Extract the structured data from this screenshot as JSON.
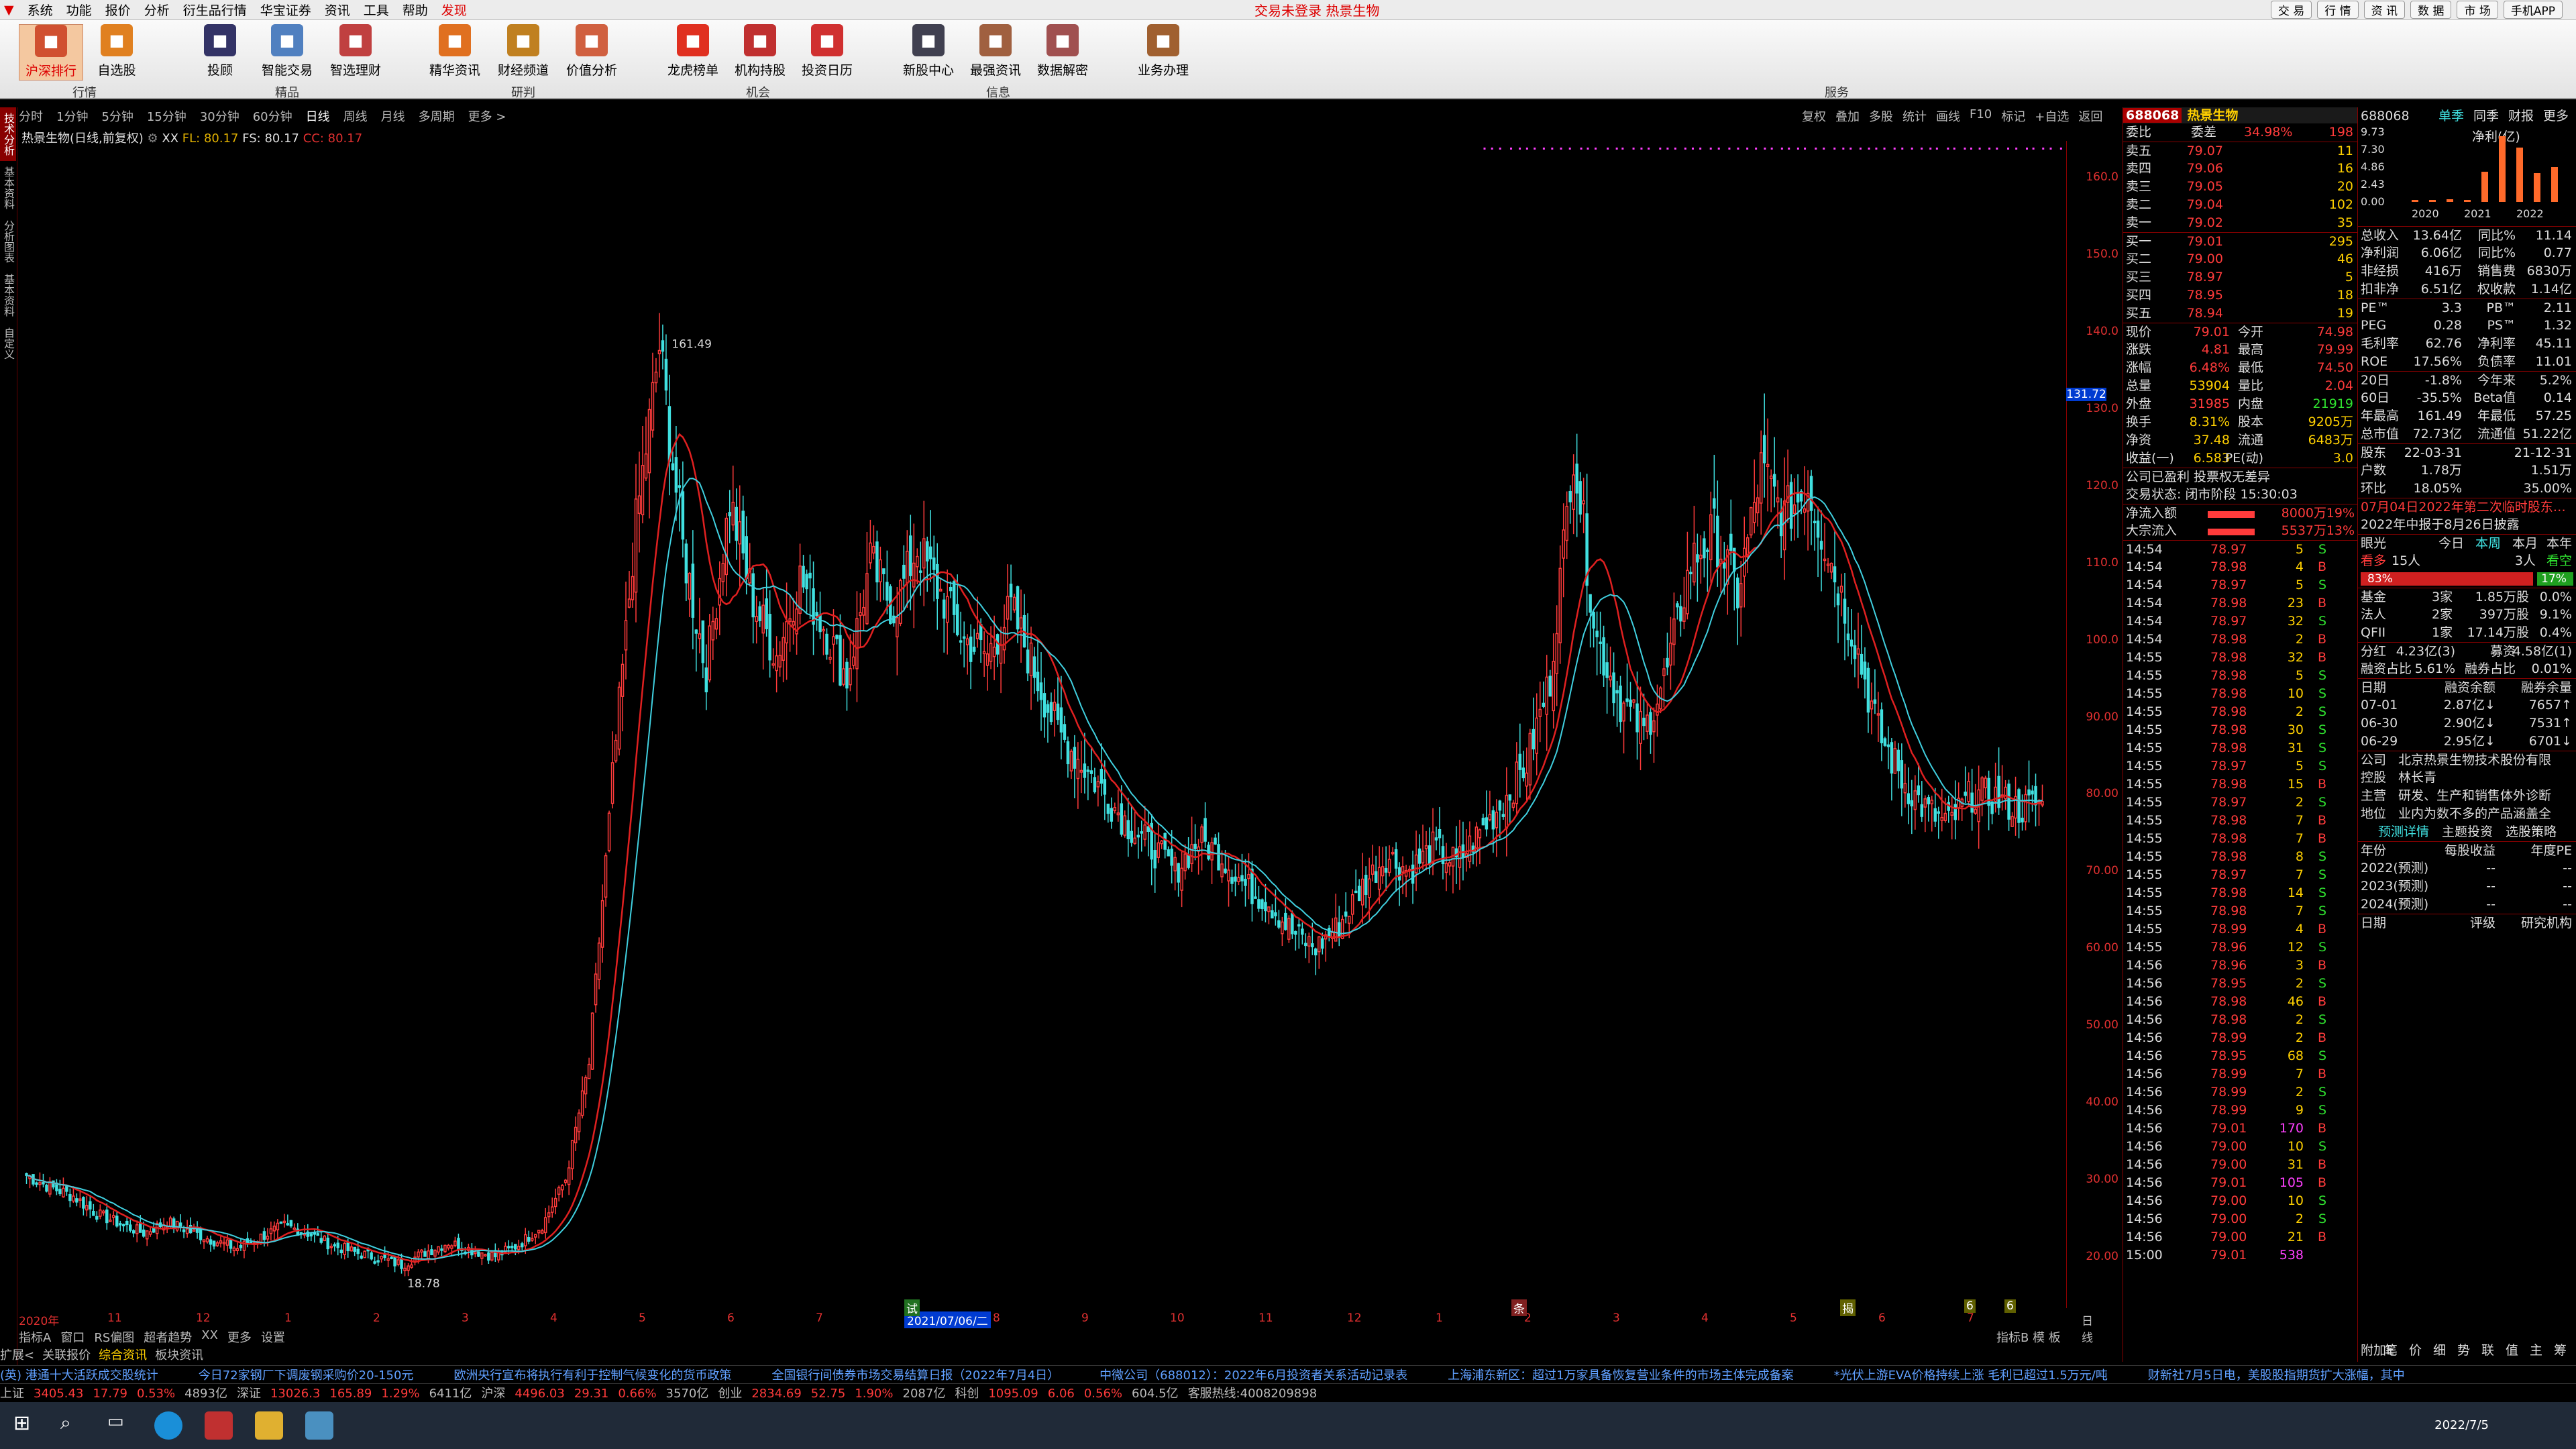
{
  "menu": {
    "items": [
      "系统",
      "功能",
      "报价",
      "分析",
      "衍生品行情",
      "华宝证券",
      "资讯",
      "工具",
      "帮助",
      "发现"
    ],
    "title": "交易未登录  热景生物",
    "right": [
      "交 易",
      "行 情",
      "资 讯",
      "数 据",
      "市 场",
      "手机APP"
    ]
  },
  "toolbar": {
    "items": [
      {
        "label": "沪深排行",
        "icon": "ranking-icon",
        "color": "#d05030"
      },
      {
        "label": "自选股",
        "icon": "star-icon",
        "color": "#e08020"
      },
      {
        "label": "投顾",
        "icon": "advisor-icon",
        "color": "#333366"
      },
      {
        "label": "智能交易",
        "icon": "smart-trade-icon",
        "color": "#5080c0"
      },
      {
        "label": "智选理财",
        "icon": "finance-icon",
        "color": "#c04040"
      },
      {
        "label": "精华资讯",
        "icon": "news-icon",
        "color": "#e07020"
      },
      {
        "label": "财经频道",
        "icon": "channel-icon",
        "color": "#c08020"
      },
      {
        "label": "价值分析",
        "icon": "value-icon",
        "color": "#d06040"
      },
      {
        "label": "龙虎榜单",
        "icon": "fire-icon",
        "color": "#e03020"
      },
      {
        "label": "机构持股",
        "icon": "institution-icon",
        "color": "#c03030"
      },
      {
        "label": "投资日历",
        "icon": "calendar-icon",
        "color": "#d03030"
      },
      {
        "label": "新股中心",
        "icon": "ipo-icon",
        "color": "#404050"
      },
      {
        "label": "最强资讯",
        "icon": "doc-icon",
        "color": "#a06040"
      },
      {
        "label": "数据解密",
        "icon": "data-icon",
        "color": "#a05050"
      },
      {
        "label": "业务办理",
        "icon": "briefcase-icon",
        "color": "#a06030"
      }
    ],
    "groups": [
      "行情",
      "精品",
      "研判",
      "机会",
      "信息",
      "服务"
    ]
  },
  "periods": [
    "分时",
    "1分钟",
    "5分钟",
    "15分钟",
    "30分钟",
    "60分钟",
    "日线",
    "周线",
    "月线",
    "多周期",
    "更多 >"
  ],
  "chart_tools": [
    "复权",
    "叠加",
    "多股",
    "统计",
    "画线",
    "F10",
    "标记",
    "+自选",
    "返回"
  ],
  "left_tabs": [
    "技术分析",
    "基本资料",
    "分析图表",
    "基本资料",
    "自定义"
  ],
  "chart_title": {
    "name": "热景生物(日线,前复权)",
    "ma1": "XX",
    "ma2": "FL: 80.17",
    "ma3": "FS: 80.17",
    "ma4": "CC: 80.17"
  },
  "y_axis": [
    "160.0",
    "150.0",
    "140.0",
    "130.0",
    "120.0",
    "110.0",
    "100.0",
    "90.00",
    "80.00",
    "70.00",
    "60.00",
    "50.00",
    "40.00",
    "30.00",
    "20.00"
  ],
  "current_price_tag": "131.72",
  "chart_data": {
    "type": "candlestick",
    "x_ticks": [
      "2020年",
      "11",
      "12",
      "1",
      "2",
      "3",
      "4",
      "5",
      "6",
      "7",
      "2021/07/06/二",
      "8",
      "9",
      "10",
      "11",
      "12",
      "1",
      "2",
      "3",
      "4",
      "5",
      "6",
      "7"
    ],
    "markers": [
      {
        "label": "试"
      },
      {
        "label": "条"
      },
      {
        "label": "揭"
      },
      {
        "label": "6"
      },
      {
        "label": "6"
      }
    ],
    "high_label": "161.49",
    "low_label": "18.78",
    "ylim": [
      15,
      163
    ],
    "series": [
      {
        "name": "FL",
        "color": "#e02020"
      },
      {
        "name": "FS",
        "color": "#40d0e0"
      }
    ],
    "closes": [
      30.5,
      29.0,
      27.8,
      25.5,
      24.2,
      23.0,
      24.5,
      23.2,
      22.0,
      21.0,
      22.5,
      24.0,
      23.0,
      21.5,
      20.5,
      19.8,
      18.9,
      20.5,
      21.8,
      20.8,
      20.0,
      21.5,
      24.0,
      30.0,
      45.0,
      82.0,
      115.0,
      138.0,
      112.0,
      96.0,
      118.0,
      105.0,
      98.0,
      108.0,
      102.0,
      95.0,
      110.0,
      104.0,
      112.0,
      106.0,
      100.0,
      98.0,
      104.0,
      96.0,
      88.0,
      84.0,
      80.0,
      76.0,
      73.0,
      70.0,
      74.0,
      72.0,
      68.0,
      66.0,
      62.0,
      60.0,
      63.0,
      68.0,
      72.0,
      70.0,
      73.0,
      71.0,
      75.0,
      79.0,
      84.0,
      95.0,
      125.0,
      100.0,
      92.0,
      88.0,
      96.0,
      110.0,
      114.0,
      106.0,
      122.0,
      116.0,
      120.0,
      110.0,
      100.0,
      88.0,
      82.0,
      78.0,
      76.0,
      80.0,
      79.5,
      78.0,
      79.0
    ]
  },
  "right_axis_tag": "日线",
  "bottom_tabs": [
    "指标A",
    "窗口",
    "RS偏图",
    "超者趋势",
    "XX",
    "更多",
    "设置"
  ],
  "bottom_tabs2": [
    "扩展<",
    "关联报价",
    "综合资讯",
    "板块资讯"
  ],
  "bottom_right_tabs": "指标B 模 板",
  "quote": {
    "code": "688068",
    "name": "热景生物",
    "ratio_label": "委比",
    "ratio": "34.98%",
    "diff_label": "委差",
    "diff": "198",
    "asks": [
      {
        "l": "卖五",
        "p": "79.07",
        "v": "11"
      },
      {
        "l": "卖四",
        "p": "79.06",
        "v": "16"
      },
      {
        "l": "卖三",
        "p": "79.05",
        "v": "20"
      },
      {
        "l": "卖二",
        "p": "79.04",
        "v": "102"
      },
      {
        "l": "卖一",
        "p": "79.02",
        "v": "35"
      }
    ],
    "bids": [
      {
        "l": "买一",
        "p": "79.01",
        "v": "295"
      },
      {
        "l": "买二",
        "p": "79.00",
        "v": "46"
      },
      {
        "l": "买三",
        "p": "78.97",
        "v": "5"
      },
      {
        "l": "买四",
        "p": "78.95",
        "v": "18"
      },
      {
        "l": "买五",
        "p": "78.94",
        "v": "19"
      }
    ],
    "stats": [
      [
        "现价",
        "79.01",
        "今开",
        "74.98"
      ],
      [
        "涨跌",
        "4.81",
        "最高",
        "79.99"
      ],
      [
        "涨幅",
        "6.48%",
        "最低",
        "74.50"
      ],
      [
        "总量",
        "53904",
        "量比",
        "2.04"
      ],
      [
        "外盘",
        "31985",
        "内盘",
        "21919"
      ],
      [
        "换手",
        "8.31%",
        "股本",
        "9205万"
      ],
      [
        "净资",
        "37.48",
        "流通",
        "6483万"
      ],
      [
        "收益(一)",
        "6.583",
        "PE(动)",
        "3.0"
      ]
    ],
    "note1": "公司已盈利 投票权无差异",
    "note2": "交易状态: 闭市阶段 15:30:03",
    "flow": [
      [
        "净流入额",
        "8000万",
        "19%"
      ],
      [
        "大宗流入",
        "5537万",
        "13%"
      ]
    ],
    "ticks": [
      [
        "14:54",
        "78.97",
        "5",
        "S"
      ],
      [
        "14:54",
        "78.98",
        "4",
        "B"
      ],
      [
        "14:54",
        "78.97",
        "5",
        "S"
      ],
      [
        "14:54",
        "78.98",
        "23",
        "B"
      ],
      [
        "14:54",
        "78.97",
        "32",
        "S"
      ],
      [
        "14:54",
        "78.98",
        "2",
        "B"
      ],
      [
        "14:55",
        "78.98",
        "32",
        "B"
      ],
      [
        "14:55",
        "78.98",
        "5",
        "S"
      ],
      [
        "14:55",
        "78.98",
        "10",
        "S"
      ],
      [
        "14:55",
        "78.98",
        "2",
        "S"
      ],
      [
        "14:55",
        "78.98",
        "30",
        "S"
      ],
      [
        "14:55",
        "78.98",
        "31",
        "S"
      ],
      [
        "14:55",
        "78.97",
        "5",
        "S"
      ],
      [
        "14:55",
        "78.98",
        "15",
        "B"
      ],
      [
        "14:55",
        "78.97",
        "2",
        "S"
      ],
      [
        "14:55",
        "78.98",
        "7",
        "B"
      ],
      [
        "14:55",
        "78.98",
        "7",
        "B"
      ],
      [
        "14:55",
        "78.98",
        "8",
        "S"
      ],
      [
        "14:55",
        "78.97",
        "7",
        "S"
      ],
      [
        "14:55",
        "78.98",
        "14",
        "S"
      ],
      [
        "14:55",
        "78.98",
        "7",
        "S"
      ],
      [
        "14:55",
        "78.99",
        "4",
        "B"
      ],
      [
        "14:55",
        "78.96",
        "12",
        "S"
      ],
      [
        "14:56",
        "78.96",
        "3",
        "B"
      ],
      [
        "14:56",
        "78.95",
        "2",
        "S"
      ],
      [
        "14:56",
        "78.98",
        "46",
        "B"
      ],
      [
        "14:56",
        "78.98",
        "2",
        "S"
      ],
      [
        "14:56",
        "78.99",
        "2",
        "B"
      ],
      [
        "14:56",
        "78.95",
        "68",
        "S"
      ],
      [
        "14:56",
        "78.99",
        "7",
        "B"
      ],
      [
        "14:56",
        "78.99",
        "2",
        "S"
      ],
      [
        "14:56",
        "78.99",
        "9",
        "S"
      ],
      [
        "14:56",
        "79.01",
        "170",
        "B"
      ],
      [
        "14:56",
        "79.00",
        "10",
        "S"
      ],
      [
        "14:56",
        "79.00",
        "31",
        "B"
      ],
      [
        "14:56",
        "79.01",
        "105",
        "B"
      ],
      [
        "14:56",
        "79.00",
        "10",
        "S"
      ],
      [
        "14:56",
        "79.00",
        "2",
        "S"
      ],
      [
        "14:56",
        "79.00",
        "21",
        "B"
      ],
      [
        "15:00",
        "79.01",
        "538",
        ""
      ]
    ]
  },
  "panel2": {
    "code": "688068",
    "tabs": [
      "单季",
      "同季",
      "财报",
      "更多"
    ],
    "profit_title": "净利(亿)",
    "years": [
      "2020",
      "2021",
      "2022"
    ],
    "yvals": [
      "9.73",
      "7.30",
      "4.86",
      "2.43",
      "0.00"
    ],
    "bars": [
      0.3,
      0.3,
      0.35,
      0.25,
      4.2,
      9.2,
      7.6,
      4.0,
      4.9
    ],
    "fin": [
      [
        "总收入",
        "13.64亿",
        "同比%",
        "11.14"
      ],
      [
        "净利润",
        "6.06亿",
        "同比%",
        "0.77"
      ],
      [
        "非经损",
        "416万",
        "销售费",
        "6830万"
      ],
      [
        "扣非净",
        "6.51亿",
        "权收款",
        "1.14亿"
      ],
      [
        "PE™",
        "3.3",
        "PB™",
        "2.11"
      ],
      [
        "PEG",
        "0.28",
        "PS™",
        "1.32"
      ],
      [
        "毛利率",
        "62.76",
        "净利率",
        "45.11"
      ],
      [
        "ROE",
        "17.56%",
        "负债率",
        "11.01"
      ],
      [
        "20日",
        "-1.8%",
        "今年来",
        "5.2%"
      ],
      [
        "60日",
        "-35.5%",
        "Beta值",
        "0.14"
      ],
      [
        "年最高",
        "161.49",
        "年最低",
        "57.25"
      ],
      [
        "总市值",
        "72.73亿",
        "流通值",
        "51.22亿"
      ]
    ],
    "holders": [
      [
        "股东",
        "22-03-31",
        "21-12-31"
      ],
      [
        "户数",
        "1.78万",
        "1.51万"
      ],
      [
        "环比",
        "18.05%",
        "35.00%"
      ]
    ],
    "notice": "07月04日2022年第二次临时股东…",
    "notice2": "2022年中报于8月26日披露",
    "view": {
      "label": "眼光",
      "t1": "今日",
      "t2": "本周",
      "t3": "本月",
      "t4": "本年",
      "bull_l": "看多",
      "bull_n": "15人",
      "bear_n": "3人",
      "bear_l": "看空",
      "bull_p": "83%",
      "bear_p": "17%"
    },
    "inst": [
      [
        "基金",
        "3家",
        "1.85万股",
        "0.0%"
      ],
      [
        "法人",
        "2家",
        "397万股",
        "9.1%"
      ],
      [
        "QFII",
        "1家",
        "17.14万股",
        "0.4%"
      ]
    ],
    "div": [
      [
        "分红",
        "4.23亿(3)",
        "募资",
        "4.58亿(1)"
      ],
      [
        "融资占比",
        "5.61%",
        "融券占比",
        "0.01%"
      ]
    ],
    "margin_head": [
      "日期",
      "融资余额",
      "融券余量"
    ],
    "margin": [
      [
        "07-01",
        "2.87亿↓",
        "7657↑"
      ],
      [
        "06-30",
        "2.90亿↓",
        "7531↑"
      ],
      [
        "06-29",
        "2.95亿↓",
        "6701↓"
      ]
    ],
    "company": [
      [
        "公司",
        "北京热景生物技术股份有限"
      ],
      [
        "控股",
        "林长青"
      ],
      [
        "主营",
        "研发、生产和销售体外诊断"
      ],
      [
        "地位",
        "业内为数不多的产品涵盖全"
      ]
    ],
    "links": [
      "预测详情",
      "主题投资",
      "选股策略"
    ],
    "forecast_head": [
      "年份",
      "每股收益",
      "年度PE"
    ],
    "forecast": [
      [
        "2022(预测)",
        "--",
        "--"
      ],
      [
        "2023(预测)",
        "--",
        "--"
      ],
      [
        "2024(预测)",
        "--",
        "--"
      ]
    ],
    "rating_head": [
      "日期",
      "评级",
      "研究机构"
    ],
    "bottom_tabs": [
      "附加E",
      "笔",
      "价",
      "细",
      "势",
      "联",
      "值",
      "主",
      "筹"
    ]
  },
  "news": [
    "(英) 港通十大活跃成交股统计",
    "今日72家钢厂下调废钢采购价20-150元",
    "欧洲央行宣布将执行有利于控制气候变化的货币政策",
    "全国银行间债券市场交易结算日报（2022年7月4日）",
    "中微公司（688012）：2022年6月投资者关系活动记录表",
    "上海浦东新区：超过1万家具备恢复营业条件的市场主体完成备案",
    "*光伏上游EVA价格持续上涨 毛利已超过1.5万元/吨",
    "财新社7月5日电，美股股指期货扩大涨幅，其中"
  ],
  "indices": [
    [
      "上证",
      "3405.43",
      "17.79",
      "0.53%",
      "4893亿"
    ],
    [
      "深证",
      "13026.3",
      "165.89",
      "1.29%",
      "6411亿"
    ],
    [
      "沪深",
      "4496.03",
      "29.31",
      "0.66%",
      "3570亿"
    ],
    [
      "创业",
      "2834.69",
      "52.75",
      "1.90%",
      "2087亿"
    ],
    [
      "科创",
      "1095.09",
      "6.06",
      "0.56%",
      "604.5亿"
    ]
  ],
  "hotline": "客服热线:4008209898",
  "clock": "2022/7/5"
}
